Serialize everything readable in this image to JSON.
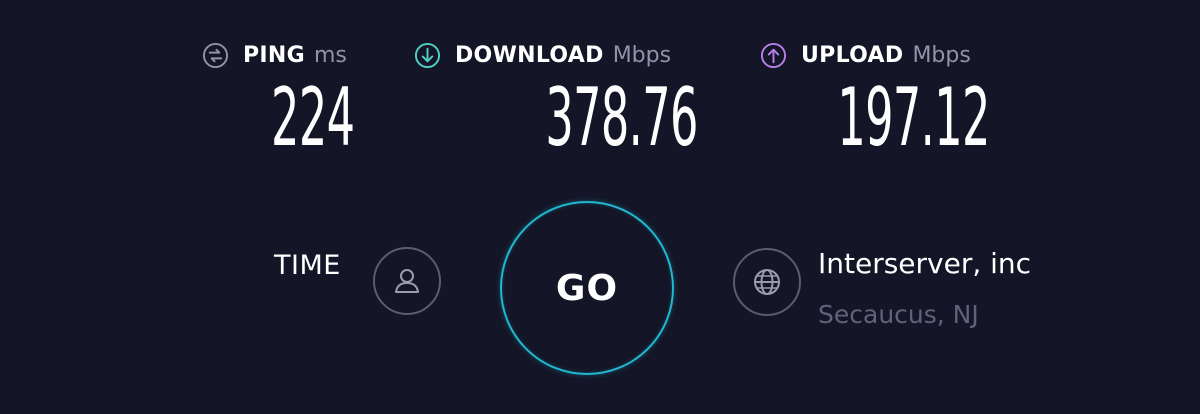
{
  "metrics": {
    "ping": {
      "label": "PING",
      "unit": "ms",
      "value": "224",
      "icon": "ping-icon",
      "icon_color": "#9193a8"
    },
    "download": {
      "label": "DOWNLOAD",
      "unit": "Mbps",
      "value": "378.76",
      "icon": "download-arrow-icon",
      "icon_color": "#4fd1c5"
    },
    "upload": {
      "label": "UPLOAD",
      "unit": "Mbps",
      "value": "197.12",
      "icon": "upload-arrow-icon",
      "icon_color": "#b57fe8"
    }
  },
  "time": {
    "label": "TIME",
    "icon": "user-icon"
  },
  "go_button": {
    "label": "GO",
    "ring_color": "#1fb8cf"
  },
  "server": {
    "name": "Interserver, inc",
    "location": "Secaucus, NJ",
    "icon": "globe-icon"
  },
  "colors": {
    "background": "#141526",
    "text": "#ffffff",
    "muted": "#9193a8",
    "location": "#60627a"
  }
}
